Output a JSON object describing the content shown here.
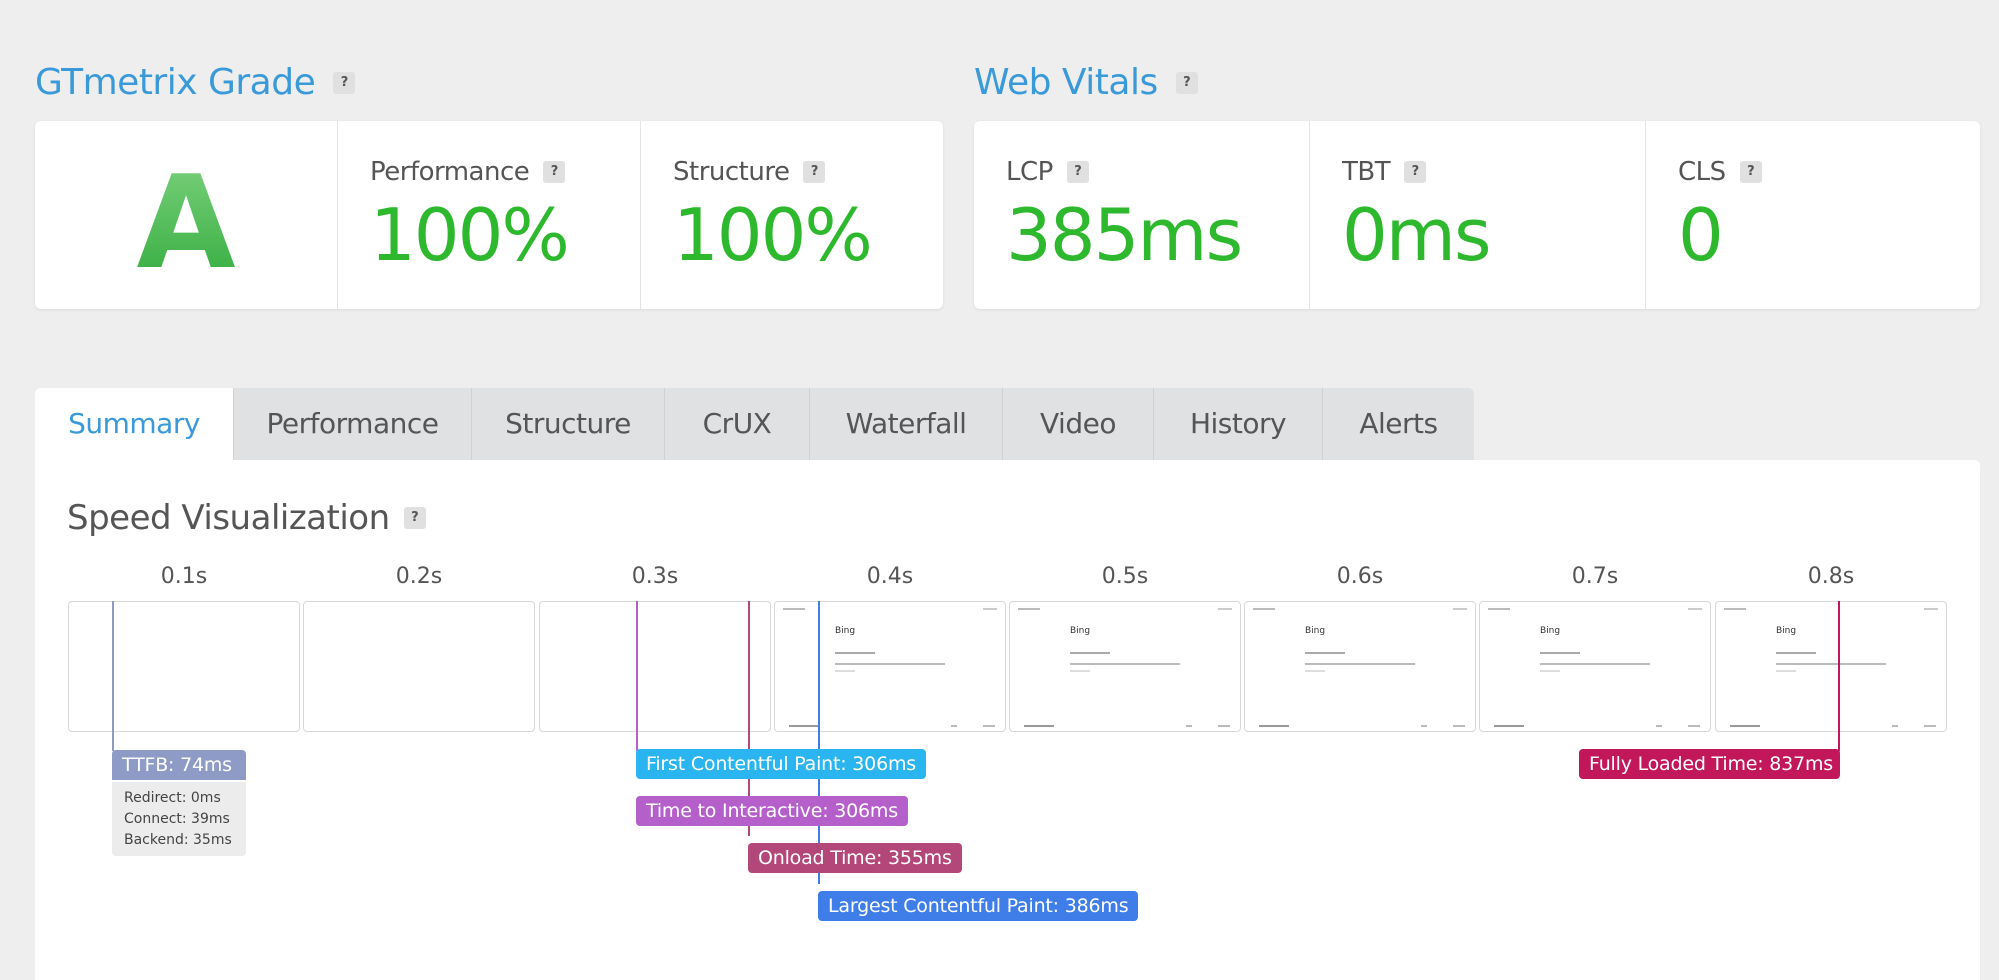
{
  "grade_section": {
    "title": "GTmetrix Grade",
    "help": "?",
    "grade": "A",
    "performance": {
      "label": "Performance",
      "help": "?",
      "value": "100%"
    },
    "structure": {
      "label": "Structure",
      "help": "?",
      "value": "100%"
    }
  },
  "vitals_section": {
    "title": "Web Vitals",
    "help": "?",
    "lcp": {
      "label": "LCP",
      "help": "?",
      "value": "385ms"
    },
    "tbt": {
      "label": "TBT",
      "help": "?",
      "value": "0ms"
    },
    "cls": {
      "label": "CLS",
      "help": "?",
      "value": "0"
    }
  },
  "tabs": [
    {
      "label": "Summary",
      "active": true
    },
    {
      "label": "Performance"
    },
    {
      "label": "Structure"
    },
    {
      "label": "CrUX"
    },
    {
      "label": "Waterfall"
    },
    {
      "label": "Video"
    },
    {
      "label": "History"
    },
    {
      "label": "Alerts"
    }
  ],
  "speed": {
    "title": "Speed Visualization",
    "help": "?",
    "ticks": [
      "0.1s",
      "0.2s",
      "0.3s",
      "0.4s",
      "0.5s",
      "0.6s",
      "0.7s",
      "0.8s"
    ],
    "thumb_title": "Bing",
    "markers": {
      "ttfb": {
        "label": "TTFB: 74ms",
        "color": "#8e9bc6",
        "details": [
          "Redirect: 0ms",
          "Connect: 39ms",
          "Backend: 35ms"
        ]
      },
      "fcp": {
        "label": "First Contentful Paint: 306ms",
        "color": "#2bb5f0"
      },
      "tti": {
        "label": "Time to Interactive: 306ms",
        "color": "#b55fcb"
      },
      "onload": {
        "label": "Onload Time: 355ms",
        "color": "#b4477a"
      },
      "lcp": {
        "label": "Largest Contentful Paint: 386ms",
        "color": "#3f7ee8"
      },
      "fully": {
        "label": "Fully Loaded Time: 837ms",
        "color": "#c2185b"
      }
    }
  }
}
